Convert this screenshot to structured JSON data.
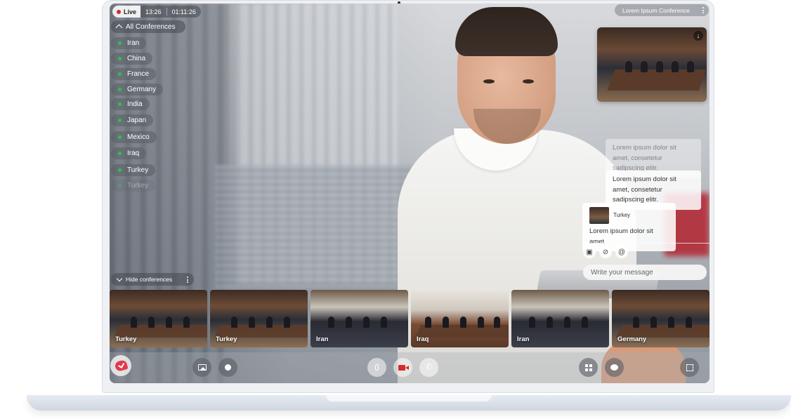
{
  "status": {
    "live_label": "Live",
    "clock": "13:26",
    "duration": "01:11:26"
  },
  "conferences": {
    "toggle_label": "All Conferences",
    "items": [
      "Iran",
      "China",
      "France",
      "Germany",
      "India",
      "Japan",
      "Mexico",
      "Iraq",
      "Turkey",
      "Turkey"
    ]
  },
  "conference_title": "Lorem Ipsum Conference",
  "chat": {
    "messages": [
      {
        "text": "Lorem ipsum dolor sit amet, consetetur sadipscing elitr."
      },
      {
        "text": "Lorem ipsum dolor sit amet, consetetur sadipscing elitr."
      }
    ],
    "incoming": {
      "sender": "Turkey",
      "text": "Lorem ipsum dolor sit amet."
    },
    "input_placeholder": "Write your message"
  },
  "hide_conferences_label": "Hide conferences",
  "thumbnails": [
    "Turkey",
    "Turkey",
    "Iran",
    "Iraq",
    "Iran",
    "Germany"
  ],
  "colors": {
    "live_red": "#d52b2b",
    "online_green": "#2fbf4f",
    "brand": "#e23a4b"
  },
  "icons": {
    "toolbar": [
      "share-screen-icon",
      "record-icon",
      "microphone-icon",
      "camera-icon",
      "phone-icon",
      "grid-icon",
      "chat-icon",
      "fullscreen-icon"
    ],
    "chat_tools": [
      "image-icon",
      "attachment-icon",
      "mention-icon"
    ]
  }
}
